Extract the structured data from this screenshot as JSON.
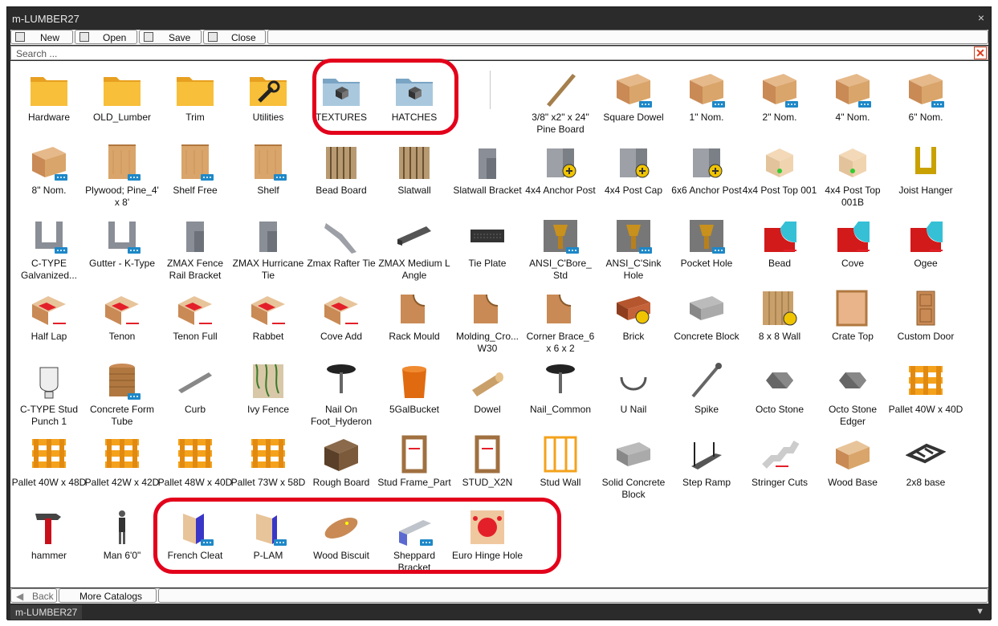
{
  "window": {
    "title": "m-LUMBER27",
    "close_glyph": "×"
  },
  "toolbar": {
    "new": "New",
    "open": "Open",
    "save": "Save",
    "close": "Close"
  },
  "search": {
    "placeholder": "Search ..."
  },
  "items": [
    [
      "Hardware",
      "OLD_Lumber",
      "Trim",
      "Utilities",
      "TEXTURES",
      "HATCHES",
      "",
      "3/8\" x2\" x 24\" Pine Board",
      "Square Dowel",
      "1\" Nom.",
      "2\" Nom.",
      "4\" Nom.",
      "6\" Nom."
    ],
    [
      "8\" Nom.",
      "Plywood; Pine_4' x 8'",
      "Shelf Free",
      "Shelf",
      "Bead Board",
      "Slatwall",
      "Slatwall Bracket",
      "4x4 Anchor Post",
      "4x4 Post Cap",
      "6x6 Anchor Post",
      "4x4 Post Top 001",
      "4x4 Post Top 001B",
      "Joist Hanger"
    ],
    [
      "C-TYPE Galvanized...",
      "Gutter - K-Type",
      "ZMAX Fence Rail Bracket",
      "ZMAX Hurricane Tie",
      "Zmax Rafter Tie",
      "ZMAX Medium L Angle",
      "Tie Plate",
      "ANSI_C'Bore_ Std",
      "ANSI_C'Sink Hole",
      "Pocket Hole",
      "Bead",
      "Cove",
      "Ogee"
    ],
    [
      "Half Lap",
      "Tenon",
      "Tenon Full",
      "Rabbet",
      "Cove Add",
      "Rack Mould",
      "Molding_Cro... W30",
      "Corner Brace_6 x 6 x 2",
      "Brick",
      "Concrete Block",
      "8 x 8 Wall",
      "Crate Top",
      "Custom Door"
    ],
    [
      "C-TYPE Stud Punch 1",
      "Concrete Form Tube",
      "Curb",
      "Ivy Fence",
      "Nail On Foot_Hyderon",
      "5GalBucket",
      "Dowel",
      "Nail_Common",
      "U Nail",
      "Spike",
      "Octo Stone",
      "Octo Stone Edger",
      "Pallet 40W x 40D"
    ],
    [
      "Pallet 40W x 48D",
      "Pallet 42W x 42D",
      "Pallet 48W x 40D",
      "Pallet 73W x 58D",
      "Rough Board",
      "Stud Frame_Part",
      "STUD_X2N",
      "Stud Wall",
      "Solid Concrete Block",
      "Step Ramp",
      "Stringer Cuts",
      "Wood Base",
      "2x8 base"
    ],
    [
      "hammer",
      "Man 6'0\"",
      "French Cleat",
      "P-LAM",
      "Wood Biscuit",
      "Sheppard Bracket",
      "Euro Hinge Hole",
      "",
      "",
      "",
      "",
      "",
      ""
    ]
  ],
  "icons": [
    [
      "folder-icon",
      "folder-icon",
      "folder-icon",
      "wrench-folder-icon",
      "texture-folder-icon",
      "hatch-folder-icon",
      "",
      "board-icon",
      "wood-block-icon",
      "wood-block-icon",
      "wood-block-icon",
      "wood-block-icon",
      "wood-block-icon"
    ],
    [
      "wood-block-icon",
      "panel-icon",
      "panel-icon",
      "panel-icon",
      "bead-board-icon",
      "slatwall-icon",
      "bracket-icon",
      "anchor-icon",
      "anchor-icon",
      "anchor-icon",
      "post-top-icon",
      "post-top-icon",
      "hanger-icon"
    ],
    [
      "channel-icon",
      "channel-icon",
      "bracket-icon",
      "bracket-icon",
      "tie-icon",
      "angle-icon",
      "plate-icon",
      "counterbore-icon",
      "countersink-icon",
      "pocket-hole-icon",
      "router-profile-icon",
      "router-profile-icon",
      "router-profile-icon"
    ],
    [
      "joint-icon",
      "joint-icon",
      "joint-icon",
      "joint-icon",
      "joint-icon",
      "moulding-icon",
      "moulding-icon",
      "moulding-icon",
      "brick-icon",
      "block-icon",
      "wall-icon",
      "crate-icon",
      "door-icon"
    ],
    [
      "punch-icon",
      "tube-icon",
      "curb-icon",
      "fence-icon",
      "nail-icon",
      "bucket-icon",
      "dowel-icon",
      "nail-icon",
      "u-nail-icon",
      "spike-icon",
      "stone-icon",
      "stone-icon",
      "pallet-icon"
    ],
    [
      "pallet-icon",
      "pallet-icon",
      "pallet-icon",
      "pallet-icon",
      "rough-board-icon",
      "frame-icon",
      "frame-icon",
      "stud-wall-icon",
      "block-icon",
      "ramp-icon",
      "stringer-icon",
      "wood-base-icon",
      "base-icon"
    ],
    [
      "hammer-icon",
      "person-icon",
      "cleat-icon",
      "laminate-icon",
      "biscuit-icon",
      "sheppard-bracket-icon",
      "hinge-hole-icon",
      "",
      "",
      "",
      "",
      "",
      ""
    ]
  ],
  "bottom": {
    "back": "Back",
    "more": "More Catalogs"
  },
  "status": {
    "tab": "m-LUMBER27",
    "dropdown_glyph": "▼"
  },
  "colors": {
    "highlight": "#e3001b",
    "folder": "#f5b731",
    "wood": "#d9a56a",
    "pallet": "#f4a21c"
  }
}
